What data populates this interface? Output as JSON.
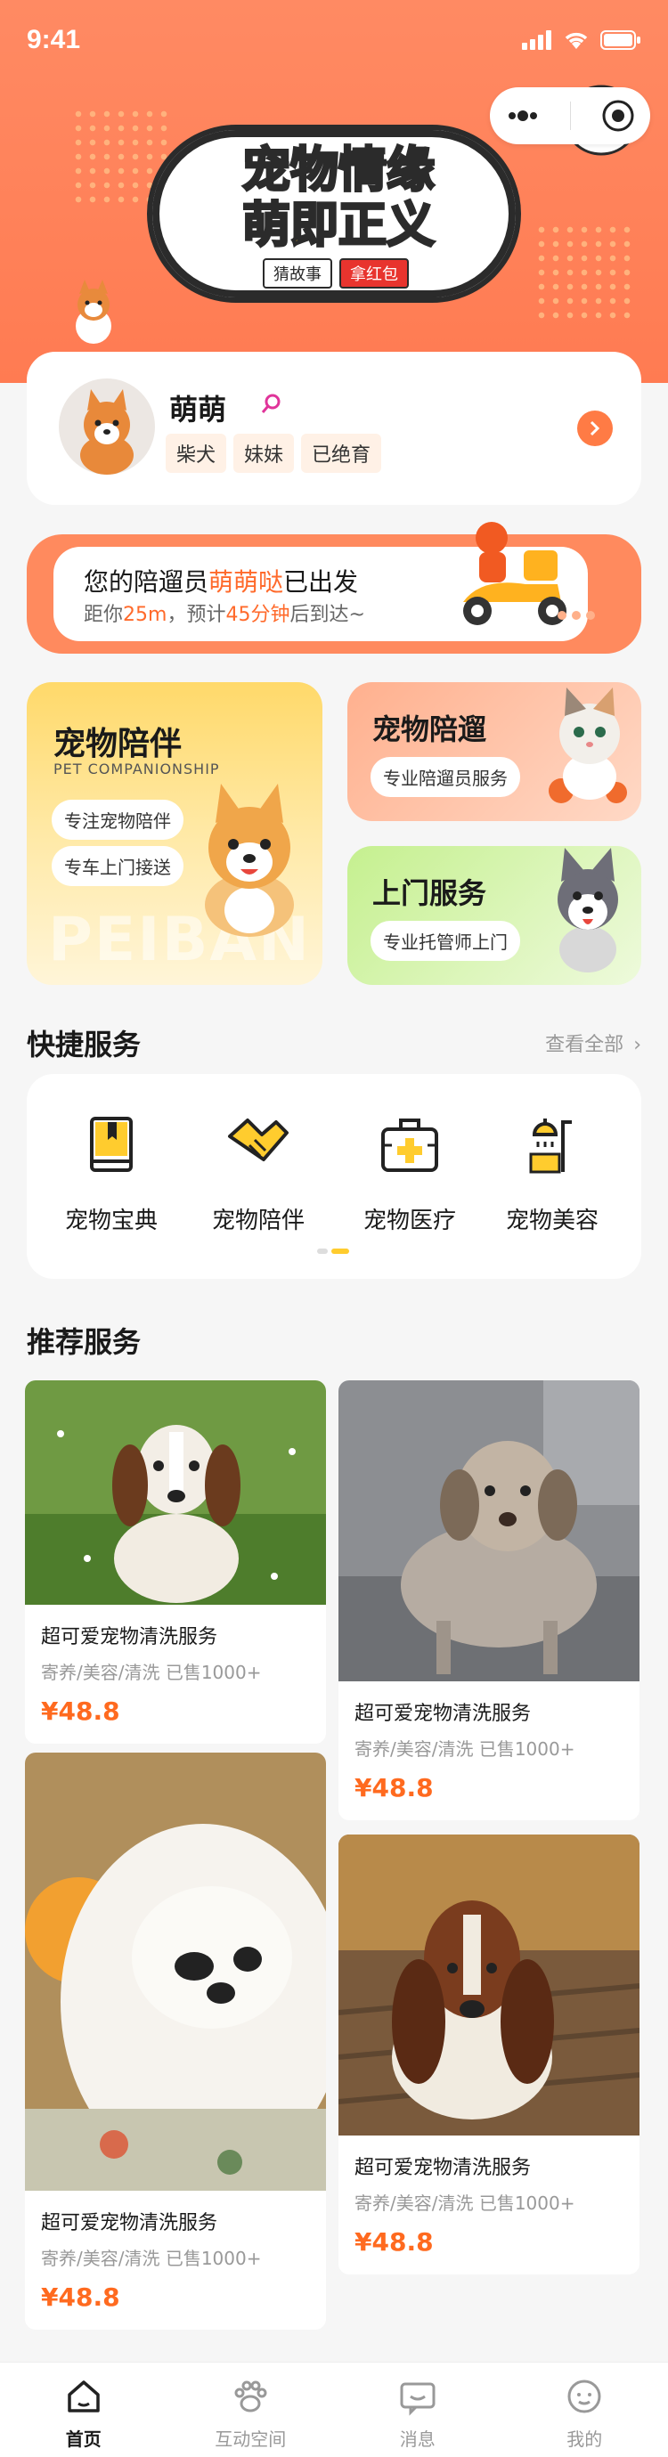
{
  "status_bar": {
    "time": "9:41"
  },
  "banner": {
    "title_line1": "宠物情缘",
    "title_line2": "萌即正义",
    "tag1": "猜故事",
    "tag2": "拿红包"
  },
  "pet_profile": {
    "name": "萌萌",
    "tags": [
      "柴犬",
      "妹妹",
      "已绝育"
    ]
  },
  "delivery": {
    "title_prefix": "您的陪遛员",
    "walker_name": "萌萌哒",
    "title_suffix": "已出发",
    "sub_prefix": "距你",
    "distance": "25m",
    "sub_mid": "，预计",
    "eta": "45分钟",
    "sub_suffix": "后到达~"
  },
  "services": {
    "companion": {
      "title": "宠物陪伴",
      "subtitle": "PET COMPANIONSHIP",
      "pill1": "专注宠物陪伴",
      "pill2": "专车上门接送",
      "watermark": "PEIBAN"
    },
    "walking": {
      "title": "宠物陪遛",
      "pill": "专业陪遛员服务"
    },
    "home": {
      "title": "上门服务",
      "pill": "专业托管师上门"
    }
  },
  "quick_services": {
    "title": "快捷服务",
    "see_all": "查看全部",
    "items": [
      {
        "label": "宠物宝典",
        "icon": "book-icon"
      },
      {
        "label": "宠物陪伴",
        "icon": "handshake-icon"
      },
      {
        "label": "宠物医疗",
        "icon": "medical-kit-icon"
      },
      {
        "label": "宠物美容",
        "icon": "shower-icon"
      }
    ]
  },
  "recommended": {
    "title": "推荐服务",
    "products": [
      {
        "name": "超可爱宠物清洗服务",
        "meta": "寄养/美容/清洗  已售1000+",
        "price": "¥48.8"
      },
      {
        "name": "超可爱宠物清洗服务",
        "meta": "寄养/美容/清洗  已售1000+",
        "price": "¥48.8"
      },
      {
        "name": "超可爱宠物清洗服务",
        "meta": "寄养/美容/清洗  已售1000+",
        "price": "¥48.8"
      },
      {
        "name": "超可爱宠物清洗服务",
        "meta": "寄养/美容/清洗  已售1000+",
        "price": "¥48.8"
      }
    ]
  },
  "tabbar": {
    "items": [
      {
        "label": "首页",
        "icon": "home-icon",
        "active": true
      },
      {
        "label": "互动空间",
        "icon": "paw-icon",
        "active": false
      },
      {
        "label": "消息",
        "icon": "message-icon",
        "active": false
      },
      {
        "label": "我的",
        "icon": "profile-icon",
        "active": false
      }
    ]
  },
  "colors": {
    "accent": "#ff7b52",
    "price": "#ff6a1f",
    "highlight": "#ff6a2b"
  }
}
